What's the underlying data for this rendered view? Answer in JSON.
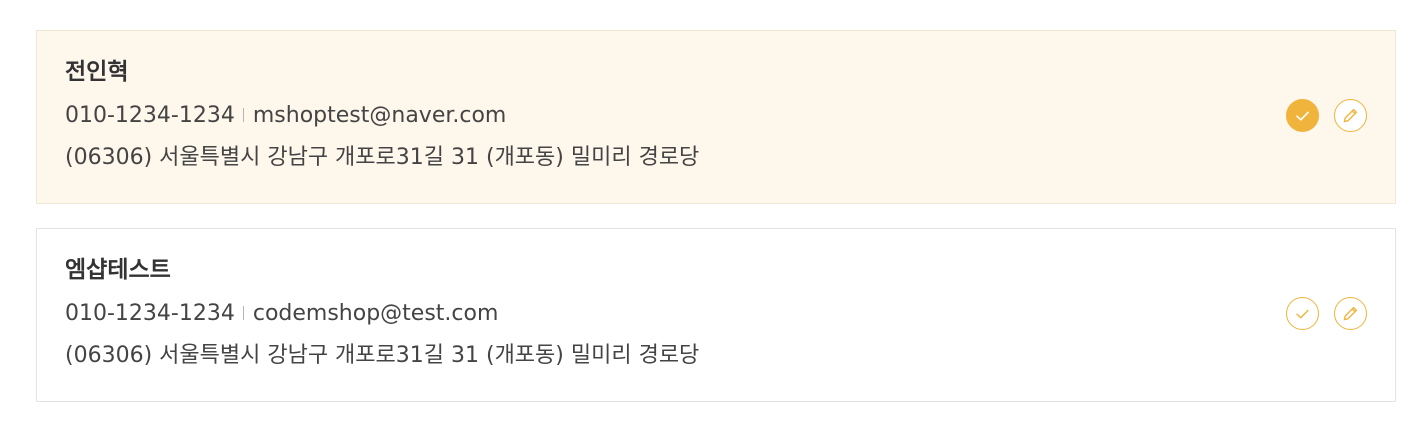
{
  "addresses": [
    {
      "name": "전인혁",
      "phone": "010-1234-1234",
      "email": "mshoptest@naver.com",
      "address": "(06306) 서울특별시 강남구 개포로31길 31 (개포동) 밀미리 경로당",
      "selected": true,
      "select_icon": "check-icon",
      "edit_icon": "pencil-icon"
    },
    {
      "name": "엠샵테스트",
      "phone": "010-1234-1234",
      "email": "codemshop@test.com",
      "address": "(06306) 서울특별시 강남구 개포로31길 31 (개포동) 밀미리 경로당",
      "selected": false,
      "select_icon": "check-icon",
      "edit_icon": "pencil-icon"
    }
  ],
  "colors": {
    "accent": "#f0b43c",
    "selected_bg": "#fdf7ec",
    "border": "#e3e3e3",
    "text": "#333333"
  }
}
